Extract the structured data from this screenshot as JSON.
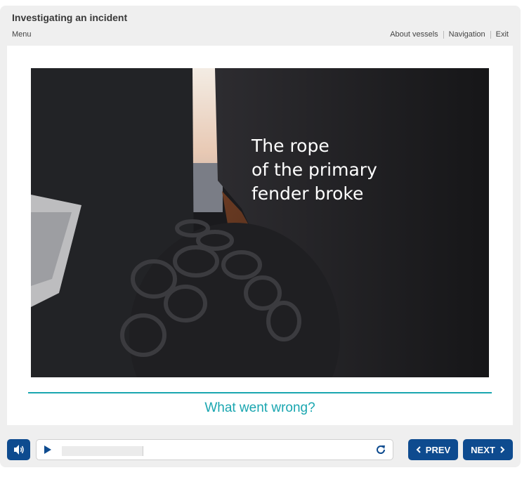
{
  "app": {
    "title": "Investigating an incident"
  },
  "topnav": {
    "menu_label": "Menu",
    "links": [
      "About vessels",
      "Navigation",
      "Exit"
    ]
  },
  "slide": {
    "caption": "The rope\nof the primary\nfender broke",
    "question": "What went wrong?"
  },
  "player": {
    "progress_fraction": 0.0,
    "icons": [
      "speaker-icon",
      "play-icon",
      "replay-icon"
    ]
  },
  "controls": {
    "prev_label": "PREV",
    "next_label": "NEXT"
  },
  "colors": {
    "accent": "#1aa6b0",
    "button": "#0e4b8f"
  }
}
